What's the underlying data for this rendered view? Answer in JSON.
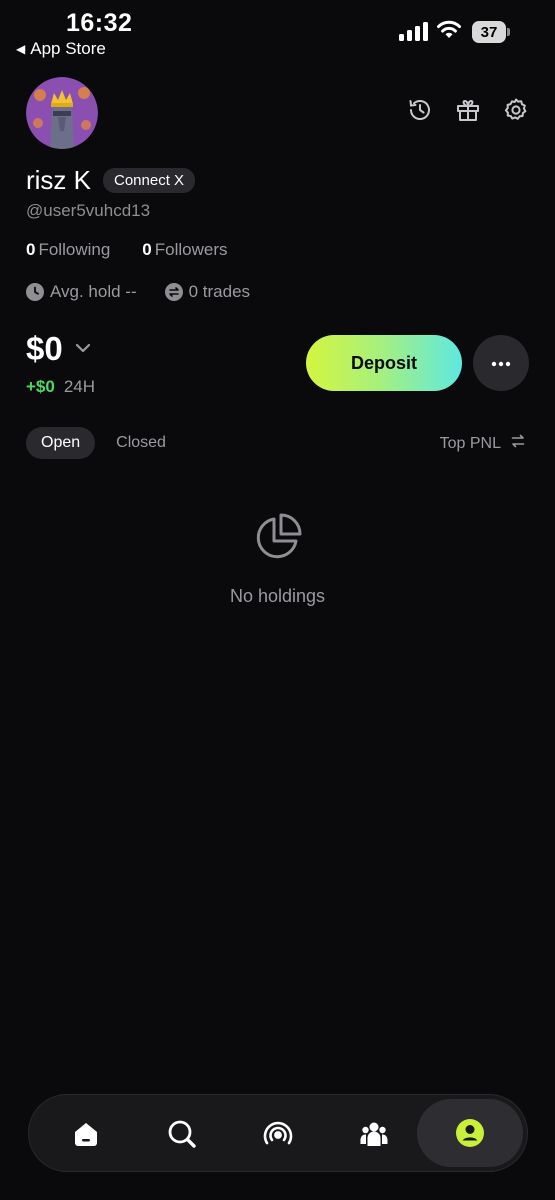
{
  "status_bar": {
    "time": "16:32",
    "back_label": "App Store",
    "battery": "37"
  },
  "profile": {
    "name": "risz K",
    "connect_label": "Connect X",
    "handle": "@user5vuhcd13",
    "following_count": "0",
    "following_label": "Following",
    "followers_count": "0",
    "followers_label": "Followers",
    "avg_hold_label": "Avg. hold --",
    "trades_label": "0 trades"
  },
  "header_icons": [
    "history-icon",
    "gift-icon",
    "settings-icon"
  ],
  "balance": {
    "amount": "$0",
    "change": "+$0",
    "period": "24H"
  },
  "actions": {
    "deposit_label": "Deposit"
  },
  "tabs": [
    {
      "label": "Open",
      "active": true
    },
    {
      "label": "Closed",
      "active": false
    }
  ],
  "sort": {
    "label": "Top PNL"
  },
  "empty_state": {
    "text": "No holdings"
  },
  "bottom_nav": [
    {
      "icon": "home-icon",
      "active": false
    },
    {
      "icon": "search-icon",
      "active": false
    },
    {
      "icon": "broadcast-icon",
      "active": false
    },
    {
      "icon": "people-icon",
      "active": false
    },
    {
      "icon": "profile-icon",
      "active": true
    }
  ],
  "colors": {
    "background": "#0a0a0c",
    "positive": "#4cd964",
    "accent_lime": "#c8f03a",
    "deposit_gradient": [
      "#d4f53f",
      "#5ee8e0"
    ]
  }
}
